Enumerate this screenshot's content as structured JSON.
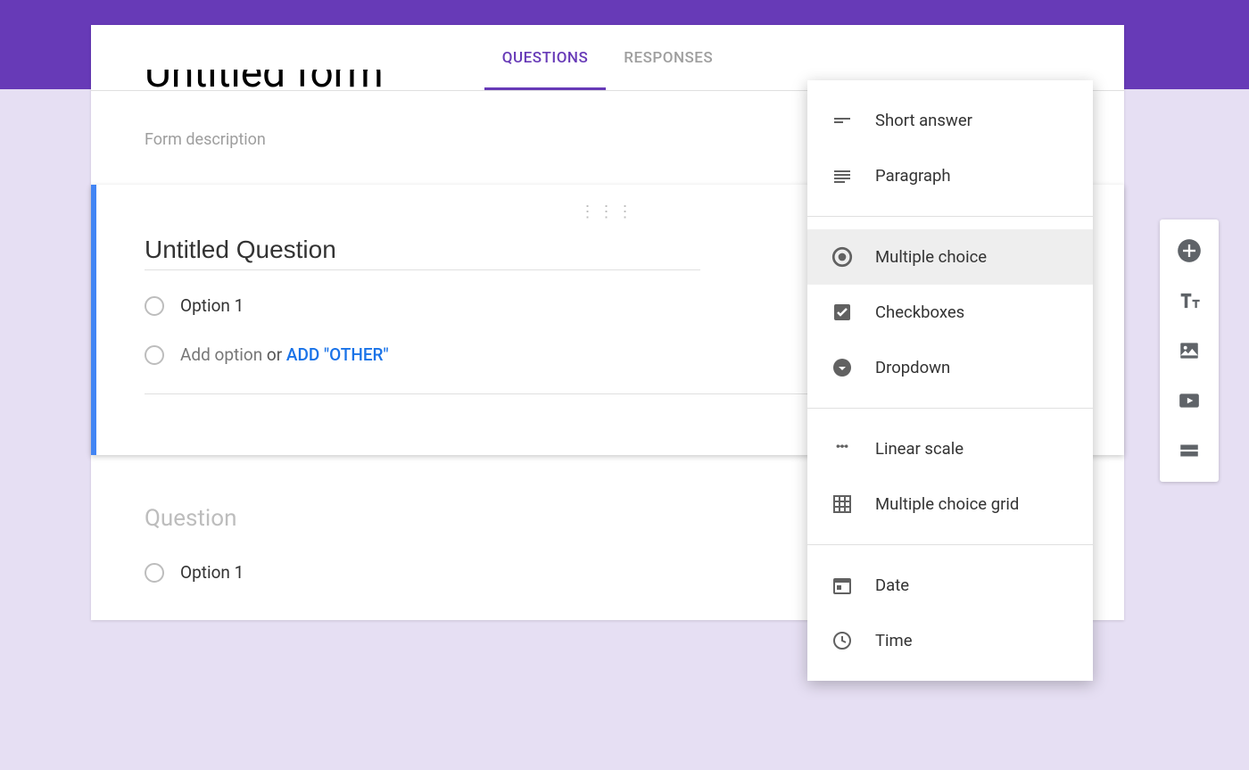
{
  "tabs": {
    "questions": "QUESTIONS",
    "responses": "RESPONSES"
  },
  "form": {
    "title": "Untitled form",
    "description_placeholder": "Form description"
  },
  "active_question": {
    "title": "Untitled Question",
    "option1": "Option 1",
    "add_option": "Add option",
    "or": " or ",
    "add_other": "ADD \"OTHER\""
  },
  "second_question": {
    "title_placeholder": "Question",
    "option1": "Option 1"
  },
  "type_menu": {
    "short_answer": "Short answer",
    "paragraph": "Paragraph",
    "multiple_choice": "Multiple choice",
    "checkboxes": "Checkboxes",
    "dropdown": "Dropdown",
    "linear_scale": "Linear scale",
    "multiple_choice_grid": "Multiple choice grid",
    "date": "Date",
    "time": "Time"
  }
}
